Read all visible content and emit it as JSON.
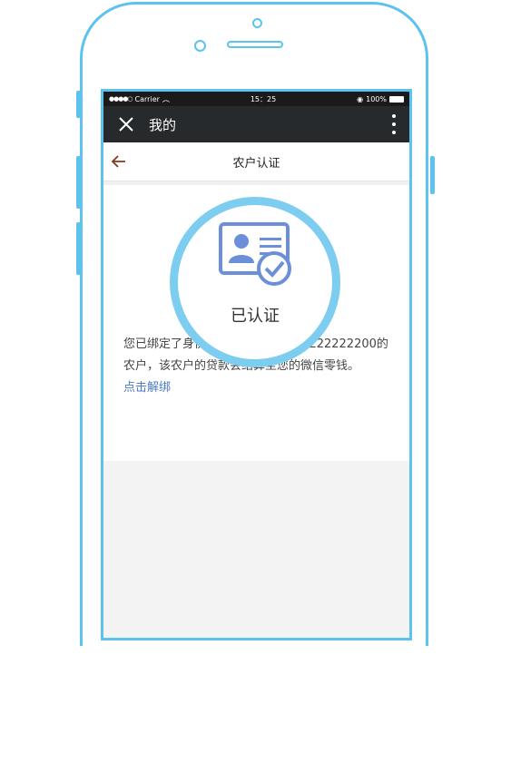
{
  "status_bar": {
    "carrier": "Carrier",
    "time": "15：25",
    "battery": "100%"
  },
  "nav": {
    "title": "我的",
    "close_icon": "close-icon",
    "more_icon": "more-vertical-icon"
  },
  "subheader": {
    "title": "农户认证",
    "back_icon": "back-arrow-icon"
  },
  "content": {
    "verified_label": "已认证",
    "info_text": "您已绑定了身份证号为412222222222222200的农户，该农户的贷款会结算至您的微信零钱。",
    "unbind_link": "点击解绑"
  },
  "colors": {
    "accent": "#5cc3ef",
    "link": "#4b7bc3",
    "nav_bg": "#262a2c",
    "icon_blue": "#6b8fd8"
  }
}
